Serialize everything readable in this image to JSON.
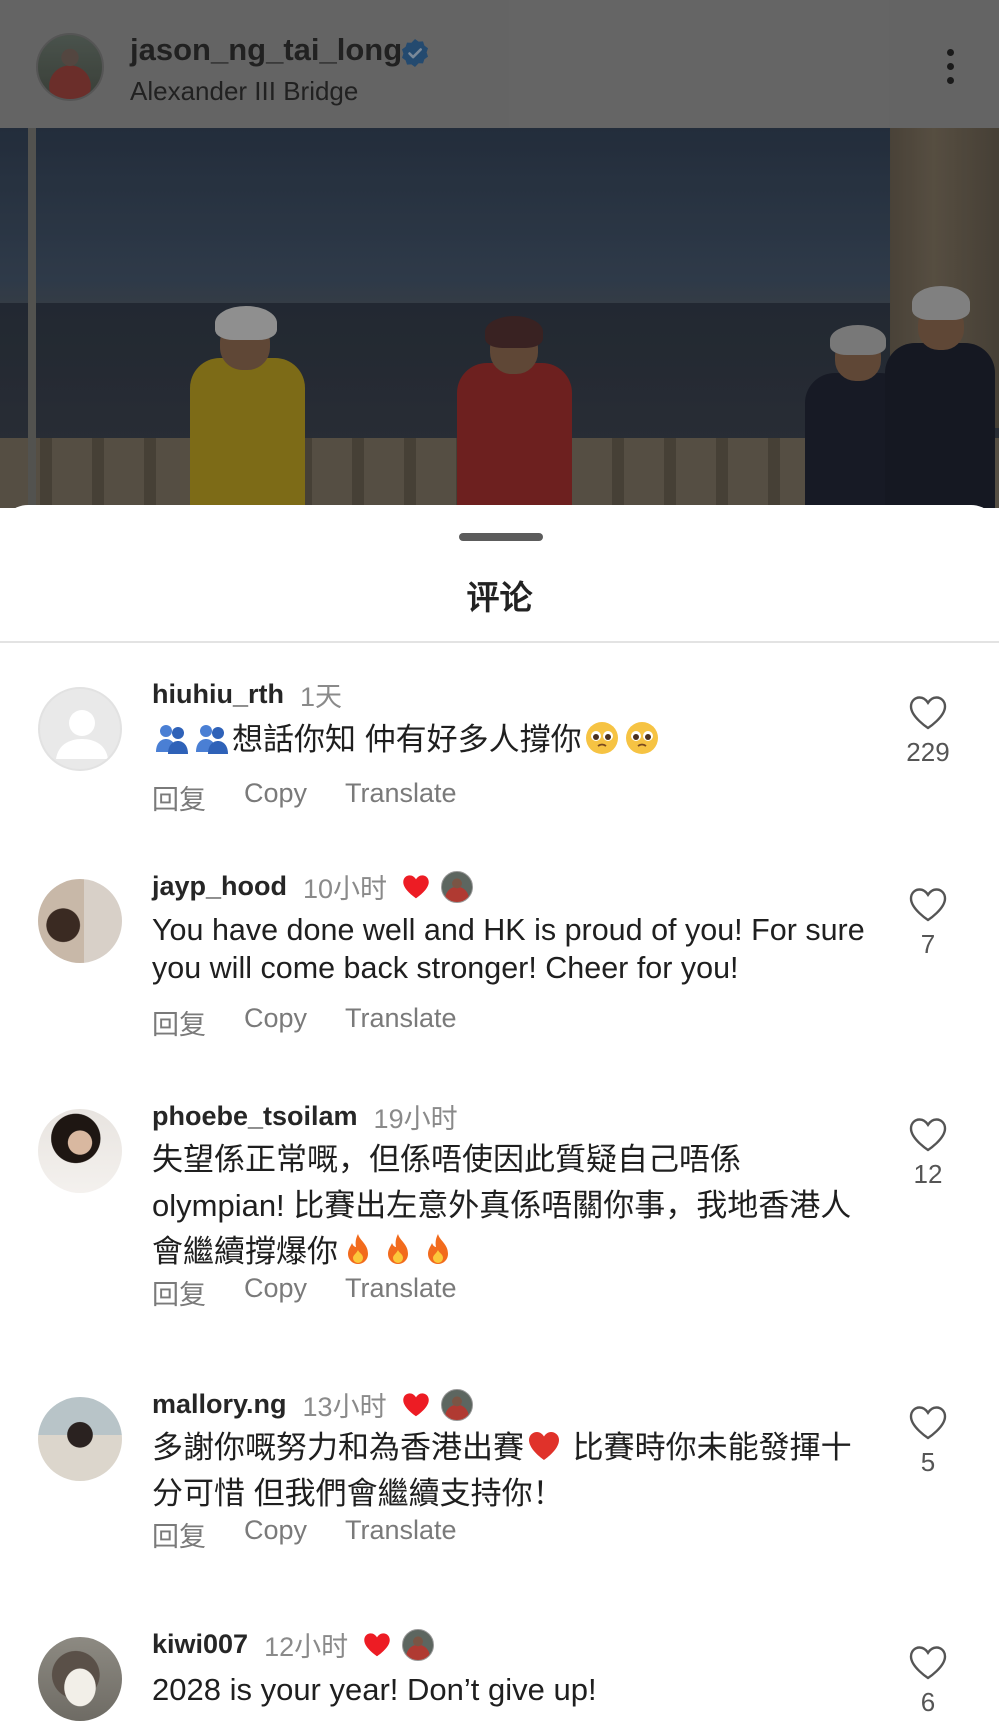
{
  "post": {
    "username": "jason_ng_tai_long",
    "location": "Alexander III Bridge",
    "verified": true
  },
  "sheet": {
    "title": "评论"
  },
  "actions": {
    "reply": "回复",
    "copy": "Copy",
    "translate": "Translate"
  },
  "comments": [
    {
      "username": "hiuhiu_rth",
      "time": "1天",
      "author_liked": false,
      "text": "想話你知 仲有好多人撐你",
      "leading_emoji": [
        "people-hugging-emoji",
        "people-hugging-emoji"
      ],
      "trailing_emoji": [
        "pleading-face-emoji",
        "pleading-face-emoji"
      ],
      "likes": "229"
    },
    {
      "username": "jayp_hood",
      "time": "10小时",
      "author_liked": true,
      "text": "You have done well and HK is proud of you! For sure you will come back stronger! Cheer for you!",
      "likes": "7"
    },
    {
      "username": "phoebe_tsoilam",
      "time": "19小时",
      "author_liked": false,
      "text": "失望係正常嘅，但係唔使因此質疑自己唔係olympian! 比賽出左意外真係唔關你事，我地香港人會繼續撐爆你",
      "trailing_emoji": [
        "fire-emoji",
        "fire-emoji",
        "fire-emoji"
      ],
      "likes": "12"
    },
    {
      "username": "mallory.ng",
      "time": "13小时",
      "author_liked": true,
      "text_before_emoji": "多謝你嘅努力和為香港出賽",
      "inline_emoji": "red-heart-emoji",
      "text_after_emoji": " 比賽時你未能發揮十分可惜 但我們會繼續支持你！",
      "likes": "5"
    },
    {
      "username": "kiwi007",
      "time": "12小时",
      "author_liked": true,
      "text": "2028 is your year! Don’t give up!",
      "likes": "6"
    }
  ],
  "colors": {
    "verified_badge": "#3897f0",
    "heart_red": "#ed1c24",
    "muted_text": "#8a8a8a",
    "header_dim": "#818181"
  }
}
